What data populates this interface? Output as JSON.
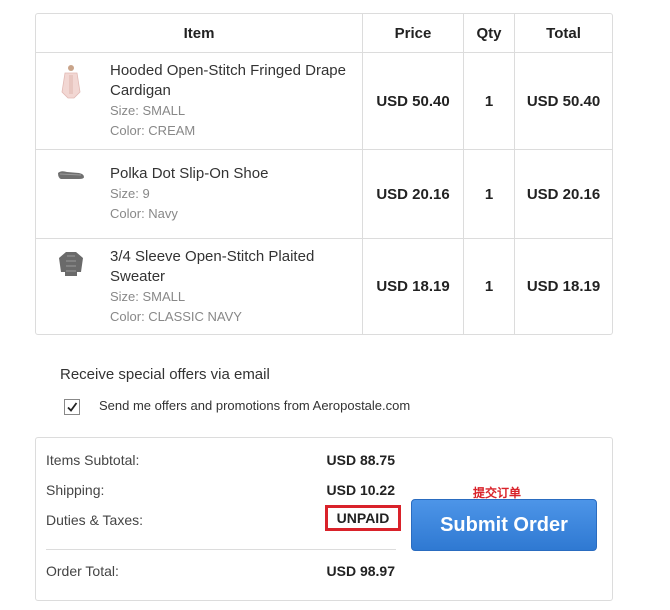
{
  "table": {
    "headers": {
      "item": "Item",
      "price": "Price",
      "qty": "Qty",
      "total": "Total"
    },
    "rows": [
      {
        "name": "Hooded Open-Stitch Fringed Drape Cardigan",
        "size": "Size: SMALL",
        "color": "Color: CREAM",
        "price": "USD 50.40",
        "qty": "1",
        "total": "USD 50.40",
        "thumb_icon": "cardigan-thumbnail"
      },
      {
        "name": "Polka Dot Slip-On Shoe",
        "size": "Size: 9",
        "color": "Color: Navy",
        "price": "USD 20.16",
        "qty": "1",
        "total": "USD 20.16",
        "thumb_icon": "shoe-thumbnail"
      },
      {
        "name": "3/4 Sleeve Open-Stitch Plaited Sweater",
        "size": "Size: SMALL",
        "color": "Color: CLASSIC NAVY",
        "price": "USD 18.19",
        "qty": "1",
        "total": "USD 18.19",
        "thumb_icon": "sweater-thumbnail"
      }
    ]
  },
  "offers": {
    "title": "Receive special offers via email",
    "checkbox_label": "Send me offers and promotions from Aeropostale.com",
    "checked": true
  },
  "totals": {
    "subtotal_label": "Items Subtotal:",
    "subtotal_value": "USD 88.75",
    "shipping_label": "Shipping:",
    "shipping_value": "USD 10.22",
    "duties_label": "Duties & Taxes:",
    "duties_value": "UNPAID",
    "order_total_label": "Order Total:",
    "order_total_value": "USD 98.97"
  },
  "submit": {
    "label": "Submit Order"
  },
  "annotation": {
    "text": "提交订单"
  },
  "colors": {
    "button_blue": "#3a86de",
    "annotation_red": "#d9222a"
  }
}
